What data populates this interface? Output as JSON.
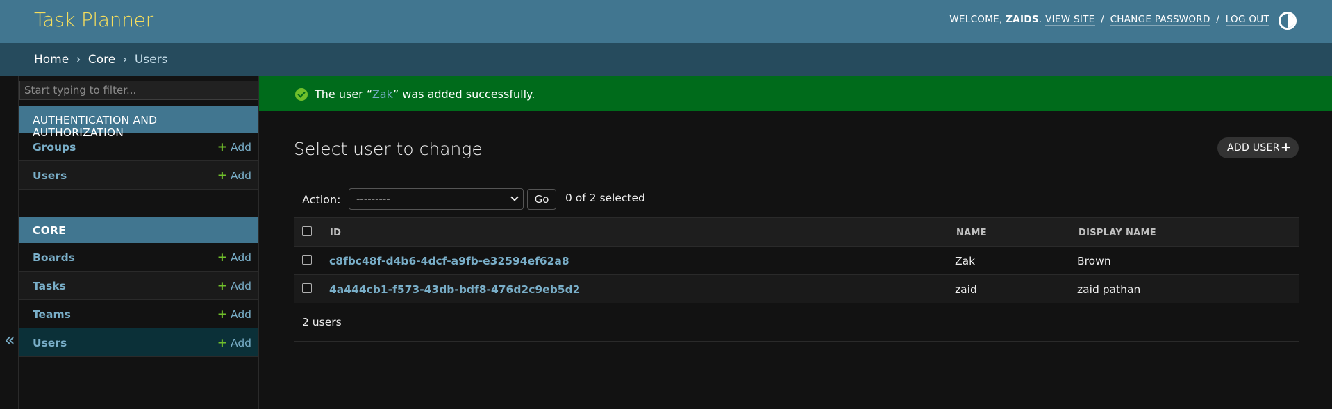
{
  "header": {
    "site_title": "Task Planner",
    "welcome": "Welcome,",
    "username": "zaids",
    "view_site": "View site",
    "change_password": "Change password",
    "log_out": "Log out",
    "separator": "/",
    "theme_icon": "theme-toggle-icon"
  },
  "breadcrumbs": {
    "items": [
      "Home",
      "Core",
      "Users"
    ],
    "separator": "›"
  },
  "sidebar": {
    "toggle_glyph": "«",
    "filter_placeholder": "Start typing to filter...",
    "modules": [
      {
        "caption": "Authentication and Authorization",
        "models": [
          {
            "name": "Groups",
            "add": "Add"
          },
          {
            "name": "Users",
            "add": "Add"
          }
        ]
      },
      {
        "caption": "Core",
        "models": [
          {
            "name": "Boards",
            "add": "Add"
          },
          {
            "name": "Tasks",
            "add": "Add"
          },
          {
            "name": "Teams",
            "add": "Add"
          },
          {
            "name": "Users",
            "add": "Add"
          }
        ]
      }
    ],
    "add_glyph": "+"
  },
  "message": {
    "prefix": "The user “",
    "link": "Zak",
    "suffix": "” was added successfully."
  },
  "content": {
    "title": "Select user to change",
    "add_button": "Add user",
    "add_glyph": "+",
    "action_label": "Action:",
    "action_value": "---------",
    "go_label": "Go",
    "selected_count": "0 of 2 selected",
    "columns": [
      "ID",
      "Name",
      "Display name"
    ],
    "rows": [
      {
        "id": "c8fbc48f-d4b6-4dcf-a9fb-e32594ef62a8",
        "name": "Zak",
        "display_name": "Brown"
      },
      {
        "id": "4a444cb1-f573-43db-bdf8-476d2c9eb5d2",
        "name": "zaid",
        "display_name": "zaid pathan"
      }
    ],
    "paginator": "2 users"
  },
  "colors": {
    "header": "#417690",
    "breadcrumbs": "#264b5d",
    "branding": "#f5dd5d",
    "link": "#79aec8",
    "success_bg": "#006b1b",
    "add_plus": "#70bf2b"
  }
}
